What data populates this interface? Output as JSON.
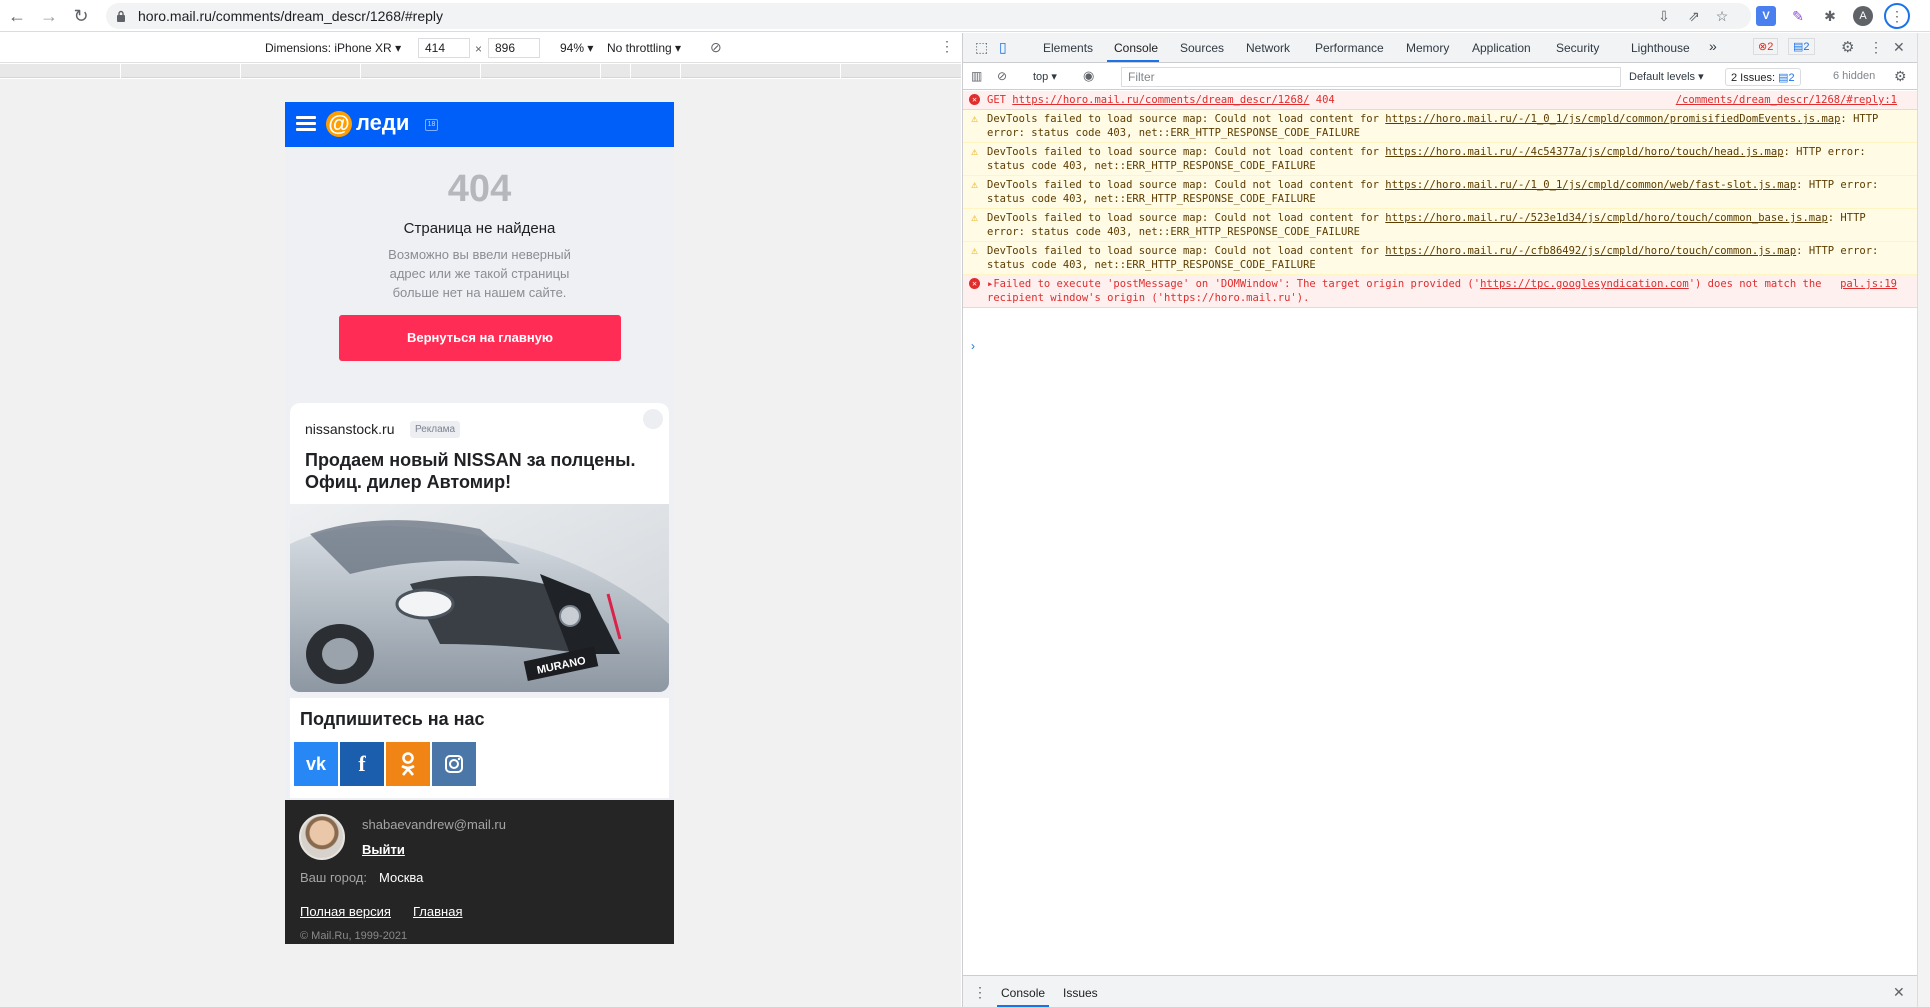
{
  "browser": {
    "url": "horo.mail.ru/comments/dream_descr/1268/#reply",
    "profile_initial": "A"
  },
  "device_toolbar": {
    "dimensions_label": "Dimensions: iPhone XR",
    "width": "414",
    "x_sep": "×",
    "height": "896",
    "zoom": "94%",
    "throttling": "No throttling"
  },
  "page": {
    "logo_text": "леди",
    "logo_at": "@",
    "error_code": "404",
    "error_title": "Страница не найдена",
    "error_text": "Возможно вы ввели неверный адрес или же такой страницы больше нет на нашем сайте.",
    "home_button": "Вернуться на главную",
    "ad": {
      "domain": "nissanstock.ru",
      "label": "Реклама",
      "title": "Продаем новый NISSAN за полцены. Офиц. дилер Автомир!",
      "plate": "MURANO"
    },
    "subscribe": {
      "title": "Подпишитесь на нас",
      "networks": [
        {
          "name": "vk",
          "glyph": "vk",
          "color": "#2787f5"
        },
        {
          "name": "facebook",
          "glyph": "f",
          "color": "#1c5eae"
        },
        {
          "name": "odnoklassniki",
          "glyph": "ok",
          "color": "#f08516"
        },
        {
          "name": "instagram",
          "glyph": "ig",
          "color": "#4a76a8"
        }
      ]
    },
    "footer": {
      "email": "shabaevandrew@mail.ru",
      "logout": "Выйти",
      "city_label": "Ваш город:",
      "city": "Москва",
      "link_full": "Полная версия",
      "link_main": "Главная",
      "copyright": "© Mail.Ru, 1999-2021"
    }
  },
  "devtools": {
    "tabs": [
      "Elements",
      "Console",
      "Sources",
      "Network",
      "Performance",
      "Memory",
      "Application",
      "Security",
      "Lighthouse"
    ],
    "active_tab": "Console",
    "more_tabs": "»",
    "error_count": "2",
    "message_count": "2",
    "context": "top",
    "filter_placeholder": "Filter",
    "levels": "Default levels",
    "issues": "2 Issues:",
    "issues_count": "2",
    "hidden": "6 hidden",
    "messages": [
      {
        "type": "err",
        "prefix": "GET ",
        "link": "https://horo.mail.ru/comments/dream_descr/1268/",
        "suffix": " 404",
        "source": "/comments/dream_descr/1268/#reply:1"
      },
      {
        "type": "warn",
        "prefix": "DevTools failed to load source map: Could not load content for ",
        "link": "https://horo.mail.ru/-/1_0_1/js/cmpld/common/promisifiedDomEvents.js.map",
        "suffix": ": HTTP error: status code 403, net::ERR_HTTP_RESPONSE_CODE_FAILURE",
        "source": ""
      },
      {
        "type": "warn",
        "prefix": "DevTools failed to load source map: Could not load content for ",
        "link": "https://horo.mail.ru/-/4c54377a/js/cmpld/horo/touch/head.js.map",
        "suffix": ": HTTP error: status code 403, net::ERR_HTTP_RESPONSE_CODE_FAILURE",
        "source": ""
      },
      {
        "type": "warn",
        "prefix": "DevTools failed to load source map: Could not load content for ",
        "link": "https://horo.mail.ru/-/1_0_1/js/cmpld/common/web/fast-slot.js.map",
        "suffix": ": HTTP error: status code 403, net::ERR_HTTP_RESPONSE_CODE_FAILURE",
        "source": ""
      },
      {
        "type": "warn",
        "prefix": "DevTools failed to load source map: Could not load content for ",
        "link": "https://horo.mail.ru/-/523e1d34/js/cmpld/horo/touch/common_base.js.map",
        "suffix": ": HTTP error: status code 403, net::ERR_HTTP_RESPONSE_CODE_FAILURE",
        "source": ""
      },
      {
        "type": "warn",
        "prefix": "DevTools failed to load source map: Could not load content for ",
        "link": "https://horo.mail.ru/-/cfb86492/js/cmpld/horo/touch/common.js.map",
        "suffix": ": HTTP error: status code 403, net::ERR_HTTP_RESPONSE_CODE_FAILURE",
        "source": ""
      },
      {
        "type": "err",
        "prefix": "▸Failed to execute 'postMessage' on 'DOMWindow': The target origin provided ('",
        "link": "https://tpc.googlesyndication.com",
        "suffix": "') does not match the recipient window's origin ('https://horo.mail.ru').",
        "source": "pal.js:19"
      }
    ],
    "prompt": "›",
    "drawer_tabs": [
      "Console",
      "Issues"
    ]
  }
}
